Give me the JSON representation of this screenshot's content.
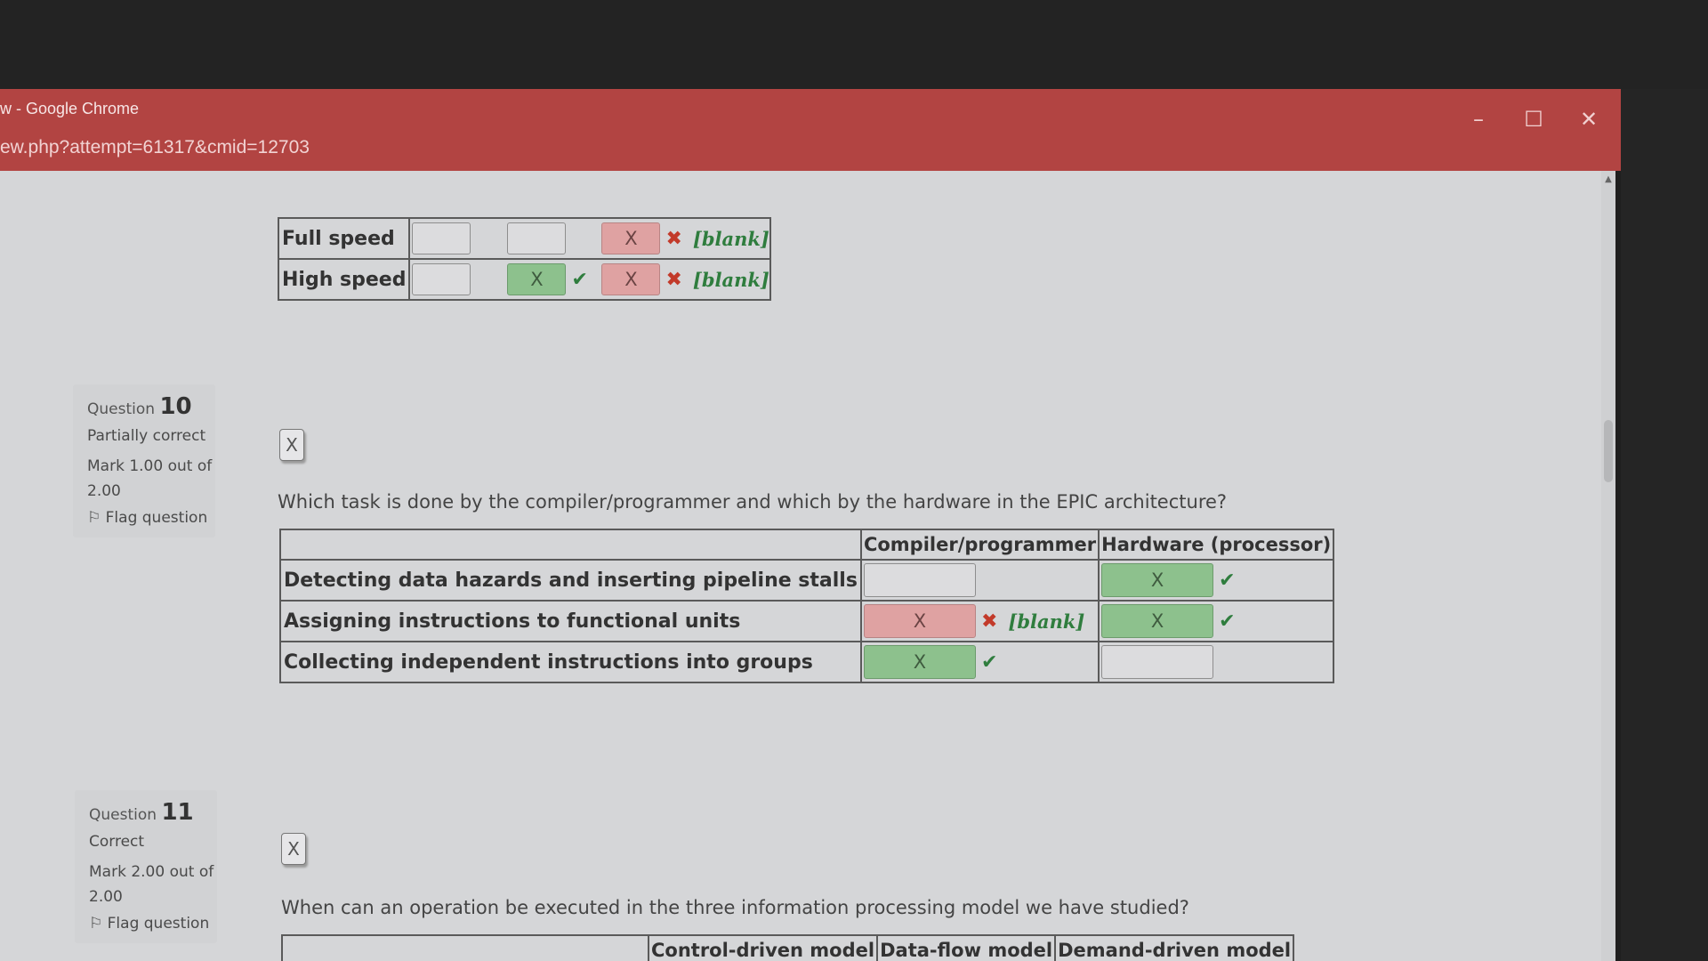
{
  "window": {
    "title": "w - Google Chrome",
    "url": "ew.php?attempt=61317&cmid=12703",
    "controls": {
      "minimize": "–",
      "maximize": "☐",
      "close": "✕"
    }
  },
  "q9_partial": {
    "rows": [
      {
        "label": "Full speed"
      },
      {
        "label": "High speed"
      }
    ],
    "box_text": "X",
    "blank": "[blank]"
  },
  "question10": {
    "number_label": "Question",
    "number": "10",
    "state": "Partially correct",
    "mark": "Mark 1.00 out of 2.00",
    "flag": "Flag question",
    "clear_box": "X",
    "text": "Which task is done by the compiler/programmer and which by the hardware in  the EPIC architecture?",
    "columns": [
      "Compiler/programmer",
      "Hardware (processor)"
    ],
    "rows": [
      {
        "label": "Detecting data hazards and inserting pipeline stalls"
      },
      {
        "label": "Assigning instructions to functional units"
      },
      {
        "label": "Collecting independent instructions into groups"
      }
    ],
    "box_text": "X",
    "blank": "[blank]"
  },
  "question11": {
    "number_label": "Question",
    "number": "11",
    "state": "Correct",
    "mark": "Mark 2.00 out of 2.00",
    "flag": "Flag question",
    "clear_box": "X",
    "text": "When can an operation be executed in the three information processing model we have studied?",
    "columns": [
      "Control-driven model",
      "Data-flow model",
      "Demand-driven model"
    ]
  },
  "colors": {
    "titlebar": "#b24442",
    "correct_box": "#8dc18d",
    "incorrect_box": "#dfa2a2",
    "check": "#2f7d3e",
    "cross": "#c23a2a"
  },
  "icons": {
    "check": "check-icon",
    "cross": "cross-icon",
    "flag": "flag-icon"
  }
}
